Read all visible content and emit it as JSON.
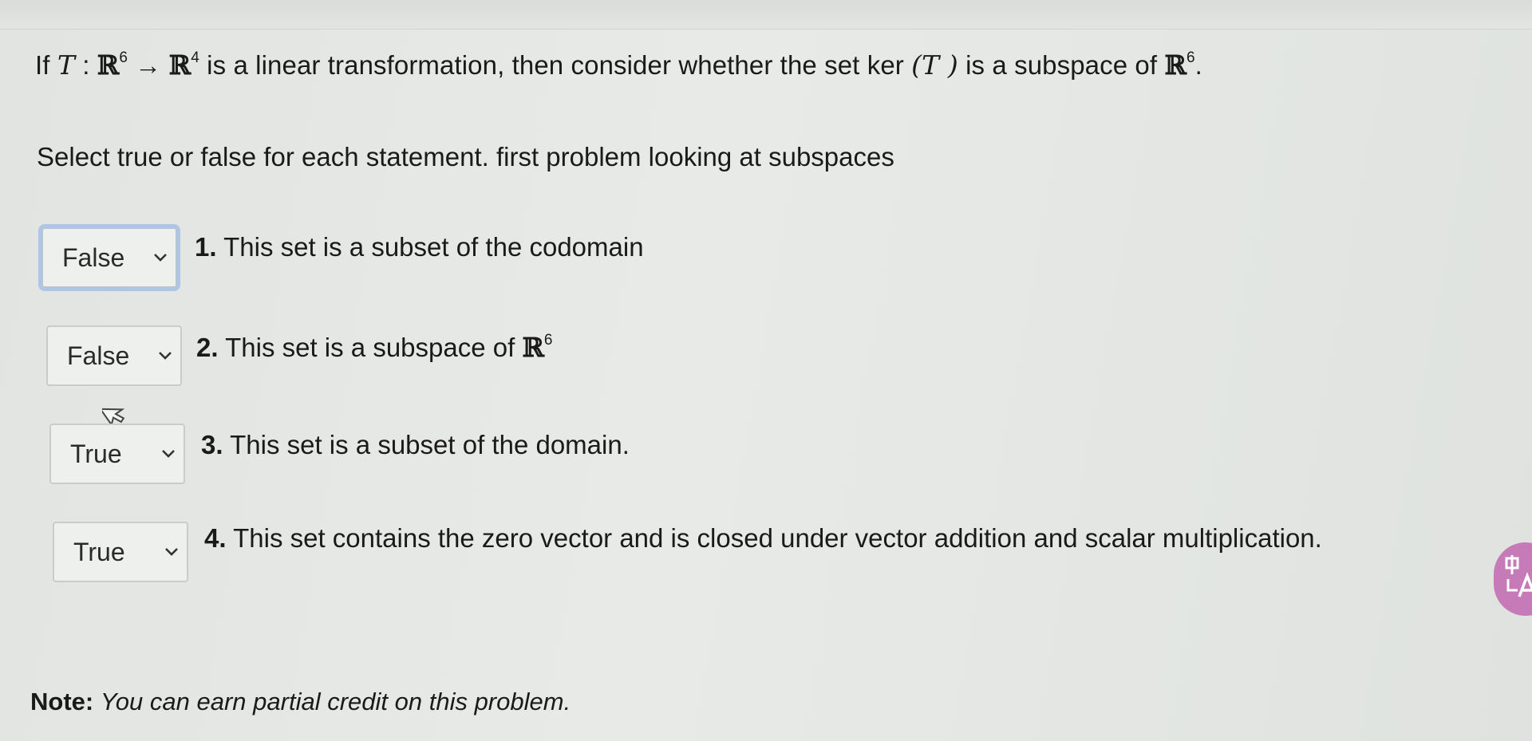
{
  "question": {
    "prefix": "If",
    "T": "T",
    "colon": ":",
    "R1": "ℝ",
    "exp1": "6",
    "arrow": "→",
    "R2": "ℝ",
    "exp2": "4",
    "middle": "is a linear transformation, then consider whether the set ker",
    "kerT": "(T )",
    "suffix": "is a subspace of",
    "R3": "ℝ",
    "exp3": "6",
    "period": "."
  },
  "instructions": "Select true or false for each statement. first problem looking at subspaces",
  "items": [
    {
      "selected": "False",
      "number": "1.",
      "text": "This set is a subset of the codomain",
      "math_R": "",
      "math_exp": ""
    },
    {
      "selected": "False",
      "number": "2.",
      "text": "This set is a subspace of",
      "math_R": "ℝ",
      "math_exp": "6"
    },
    {
      "selected": "True",
      "number": "3.",
      "text": "This set is a subset of the domain.",
      "math_R": "",
      "math_exp": ""
    },
    {
      "selected": "True",
      "number": "4.",
      "text": "This set contains the zero vector and is closed under vector addition and scalar multiplication.",
      "math_R": "",
      "math_exp": ""
    }
  ],
  "note": {
    "label": "Note:",
    "text": "You can earn partial credit on this problem."
  },
  "translate_button": {
    "icon": "translate-icon",
    "glyph": "中A",
    "color": "#c77ab8"
  },
  "icons": {
    "chevron": "chevron-down-icon",
    "cursor": "mouse-cursor-icon"
  }
}
